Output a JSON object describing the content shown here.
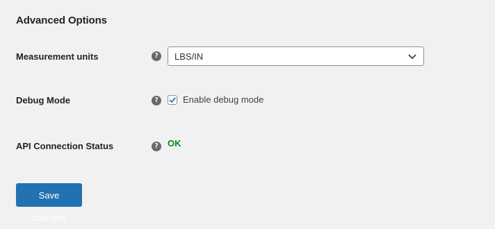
{
  "section": {
    "title": "Advanced Options"
  },
  "rows": {
    "measurement": {
      "label": "Measurement units",
      "help_icon": "question-circle-icon",
      "selected_value": "LBS/IN"
    },
    "debug": {
      "label": "Debug Mode",
      "help_icon": "question-circle-icon",
      "checkbox_label": "Enable debug mode",
      "checked": true
    },
    "api_status": {
      "label": "API Connection Status",
      "help_icon": "question-circle-icon",
      "status_text": "OK"
    }
  },
  "actions": {
    "save_label": "Save changes"
  },
  "colors": {
    "background": "#f1f1f1",
    "primary_button": "#2271b1",
    "status_ok": "#008a20",
    "checkmark": "#2271b1"
  }
}
